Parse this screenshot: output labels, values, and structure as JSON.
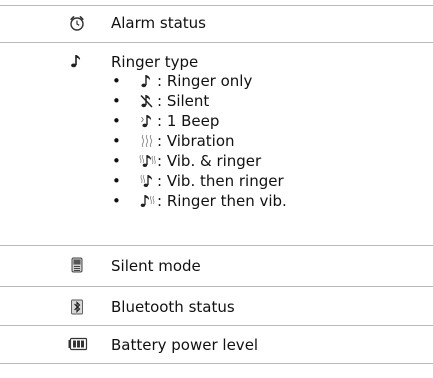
{
  "rows": [
    {
      "label": "Alarm status",
      "icon": "alarm-clock-icon"
    },
    {
      "label": "Ringer type",
      "icon": "music-note-icon",
      "items": [
        {
          "icon": "music-note-icon",
          "text": ": Ringer only"
        },
        {
          "icon": "silent-note-icon",
          "text": ": Silent"
        },
        {
          "icon": "beep-note-icon",
          "text": ": 1 Beep"
        },
        {
          "icon": "vibration-icon",
          "text": ": Vibration"
        },
        {
          "icon": "vibration-and-ringer-icon",
          "text": ": Vib. & ringer"
        },
        {
          "icon": "vibration-then-ringer-icon",
          "text": ": Vib. then ringer"
        },
        {
          "icon": "ringer-then-vibration-icon",
          "text": ": Ringer then vib."
        }
      ]
    },
    {
      "label": "Silent mode",
      "icon": "silent-mode-phone-icon"
    },
    {
      "label": "Bluetooth status",
      "icon": "bluetooth-icon"
    },
    {
      "label": "Battery power level",
      "icon": "battery-icon"
    }
  ],
  "bullet": "•"
}
